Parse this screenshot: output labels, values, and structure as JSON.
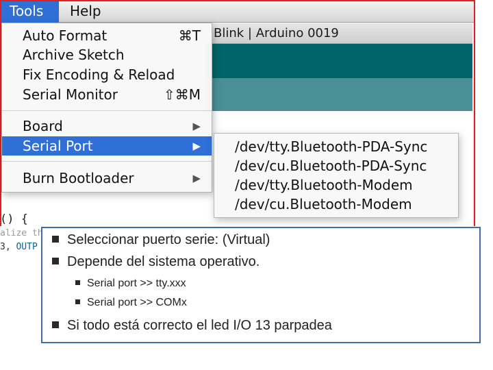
{
  "menubar": {
    "tools": "Tools",
    "help": "Help"
  },
  "window": {
    "title": "Blink | Arduino 0019"
  },
  "tools_menu": {
    "items": [
      {
        "label": "Auto Format",
        "shortcut": "⌘T"
      },
      {
        "label": "Archive Sketch",
        "shortcut": ""
      },
      {
        "label": "Fix Encoding & Reload",
        "shortcut": ""
      },
      {
        "label": "Serial Monitor",
        "shortcut": "⇧⌘M"
      },
      {
        "label": "Board",
        "submenu": true
      },
      {
        "label": "Serial Port",
        "submenu": true,
        "selected": true
      },
      {
        "label": "Burn Bootloader",
        "submenu": true
      }
    ]
  },
  "serial_ports": [
    "/dev/tty.Bluetooth-PDA-Sync",
    "/dev/cu.Bluetooth-PDA-Sync",
    "/dev/tty.Bluetooth-Modem",
    "/dev/cu.Bluetooth-Modem"
  ],
  "code": {
    "line1": "() {",
    "line2": "alize th",
    "line3_a": "3, ",
    "line3_b": "OUTP"
  },
  "notes": {
    "b1": "Seleccionar puerto serie: (Virtual)",
    "b2": "Depende del sistema operativo.",
    "b3": "Serial port >> tty.xxx",
    "b4": "Serial port >> COMx",
    "b5": "Si todo está correcto el led I/O 13 parpadea"
  },
  "icons": {
    "submenu_arrow": "triangle-right-icon",
    "bullet": "square-bullet-icon"
  },
  "colors": {
    "highlight": "#2f6fd6",
    "toolbar": "#006468",
    "note_border": "#3f6ea5",
    "frame": "#e02020"
  }
}
